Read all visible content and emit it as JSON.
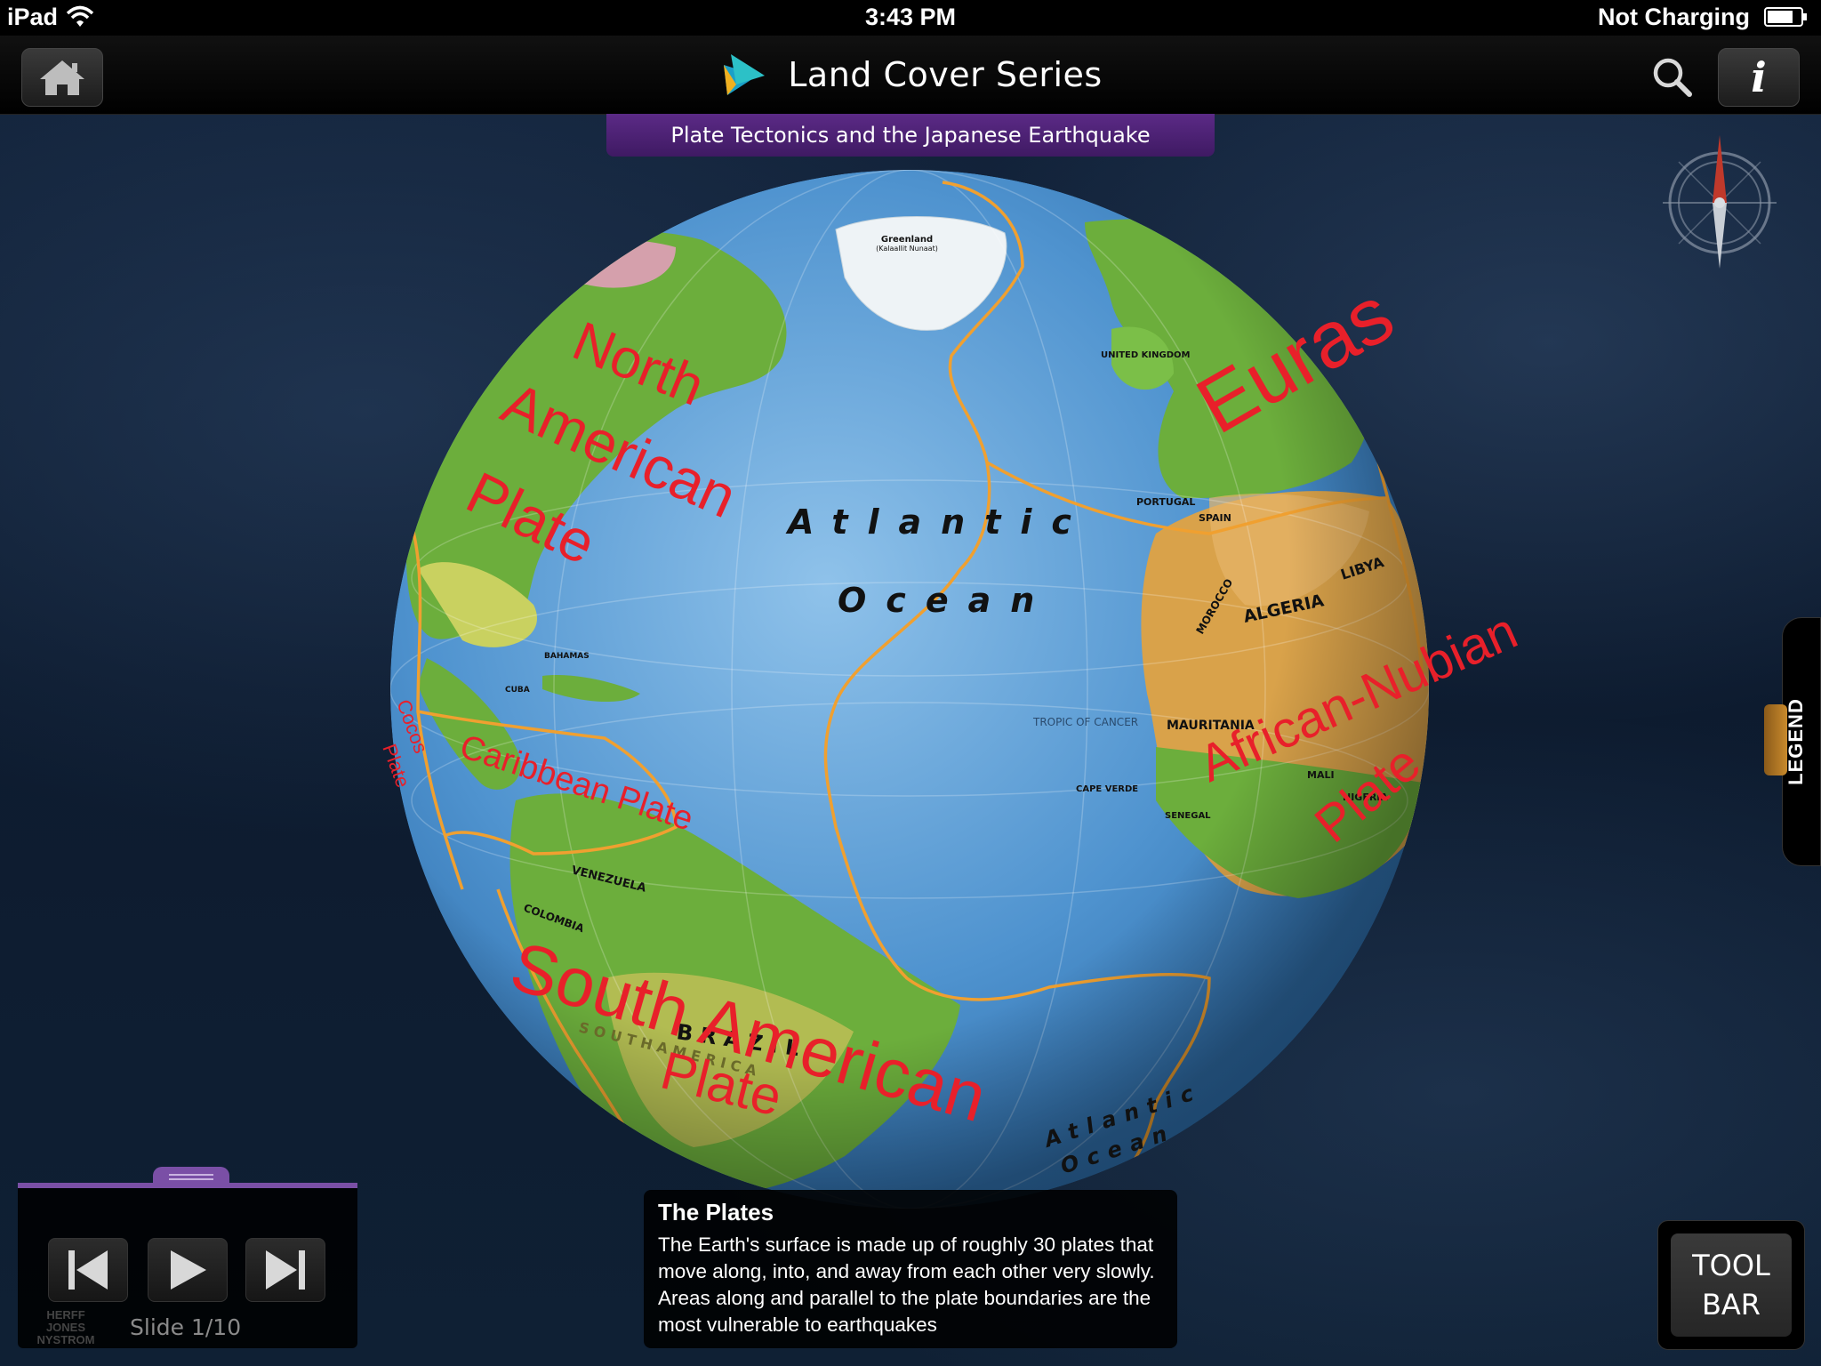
{
  "status_bar": {
    "carrier": "iPad",
    "time": "3:43 PM",
    "charging_status": "Not Charging"
  },
  "nav": {
    "title": "Land Cover Series",
    "home_icon": "home-icon",
    "search_icon": "search-icon",
    "info_icon": "info-icon",
    "info_label": "i"
  },
  "topic": {
    "title": "Plate Tectonics and the Japanese Earthquake"
  },
  "globe": {
    "ocean_labels": [
      "Atlantic",
      "Ocean",
      "Atlantic",
      "Ocean"
    ],
    "plate_labels": {
      "north_american_1": "North",
      "north_american_2": "American",
      "north_american_3": "Plate",
      "eurasian": "Euras",
      "african": "African-Nubian",
      "african_plate": "Plate",
      "caribbean": "Caribbean Plate",
      "cocos_1": "Cocos",
      "cocos_2": "Plate",
      "south_american_1": "South American",
      "south_american_2": "Plate"
    },
    "map_labels": {
      "greenland": "Greenland",
      "greenland_sub": "(Kalaallit Nunaat)",
      "algeria": "ALGERIA",
      "libya": "LIBYA",
      "morocco": "MOROCCO",
      "mauritania": "MAURITANIA",
      "venezuela": "VENEZUELA",
      "colombia": "COLOMBIA",
      "brazil": "B R A Z I L",
      "south_america": "S O U T H   A M E R I C A",
      "portugal": "PORTUGAL",
      "spain": "SPAIN",
      "united_kingdom": "UNITED KINGDOM",
      "bahamas": "BAHAMAS",
      "cuba": "CUBA",
      "tropic": "TROPIC OF CANCER",
      "cape_verde": "CAPE VERDE",
      "senegal": "SENEGAL",
      "nigeria": "NIGERIA",
      "mali": "MALI"
    },
    "colors": {
      "ocean": "#4f93cf",
      "land": "#6cae3c",
      "desert": "#d9a24a",
      "plate_boundary": "#f0a030",
      "plate_label": "#e8202a"
    }
  },
  "legend": {
    "label": "LEGEND"
  },
  "compass": {
    "icon": "compass-icon"
  },
  "player": {
    "prev_icon": "skip-back-icon",
    "play_icon": "play-icon",
    "next_icon": "skip-forward-icon",
    "brand": "HERFF JONES NYSTROM",
    "slide_counter": "Slide 1/10"
  },
  "caption": {
    "title": "The Plates",
    "body": "The Earth's surface is made up of roughly 30 plates that move along, into, and away from each other very slowly. Areas along and parallel to the plate boundaries are the most vulnerable to earthquakes"
  },
  "toolbar": {
    "label": "TOOL\nBAR"
  }
}
